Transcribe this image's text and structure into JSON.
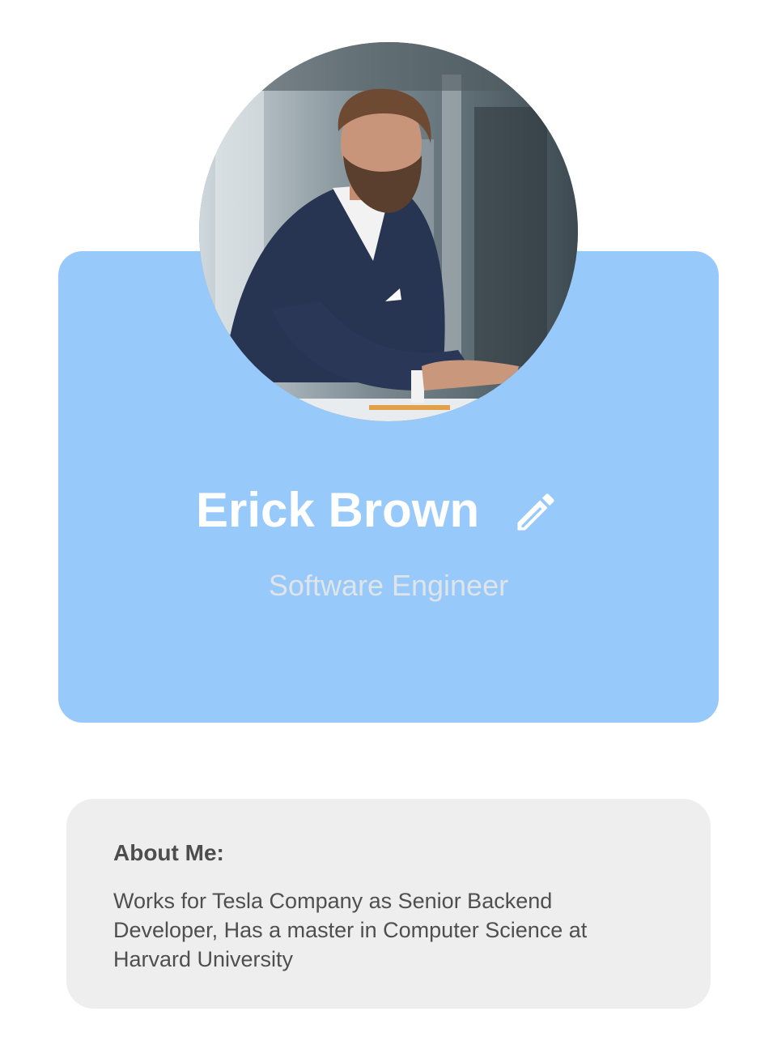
{
  "profile": {
    "name": "Erick Brown",
    "job_title": "Software Engineer",
    "photo_description": "avatar-photo"
  },
  "about": {
    "heading": "About Me:",
    "text": "Works for Tesla Company as Senior Backend Developer, Has a master in Computer Science at Harvard University"
  },
  "colors": {
    "card_background": "#97c9fb",
    "about_background": "#eeeeee",
    "name_color": "#ffffff",
    "job_title_color": "#dfe4e9",
    "text_color": "#4f4f4f"
  },
  "icons": {
    "edit": "pencil-icon"
  }
}
